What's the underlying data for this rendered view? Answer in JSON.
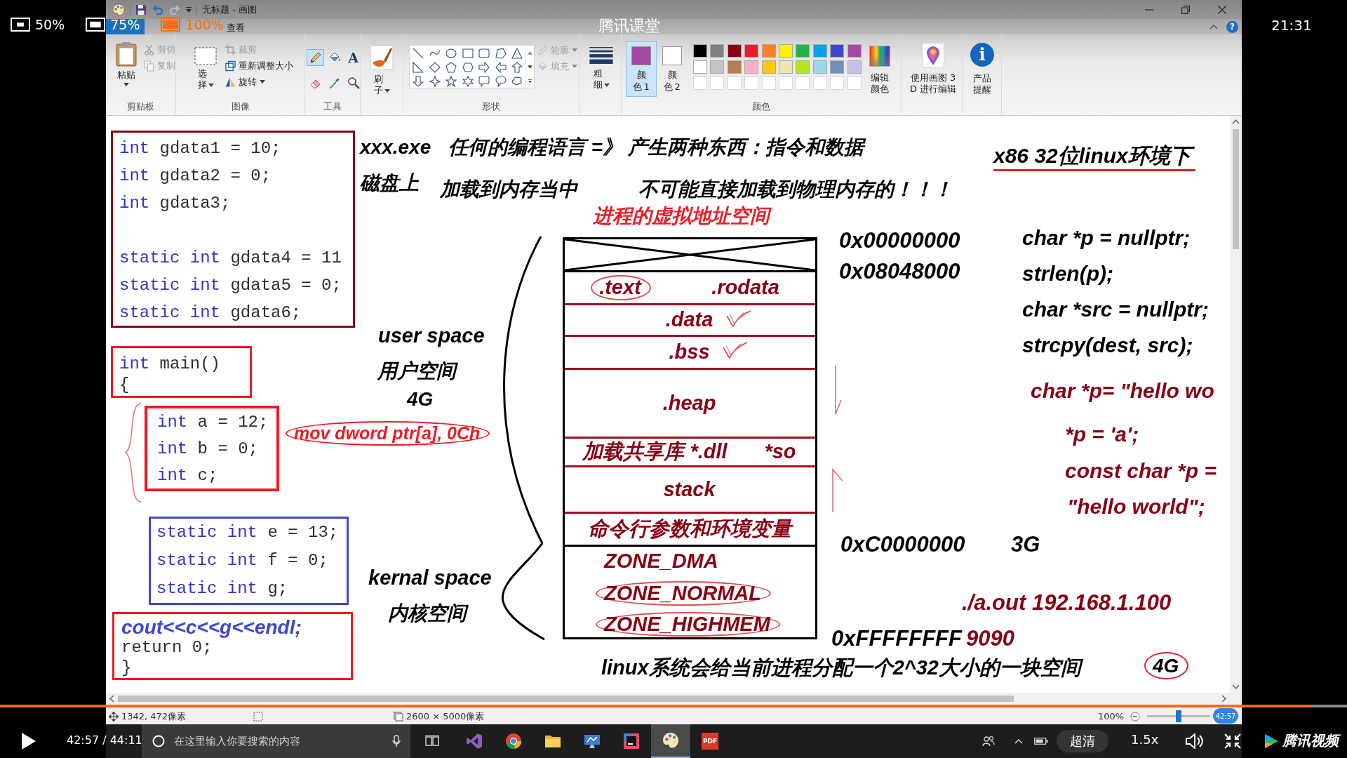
{
  "player": {
    "screen_options": [
      {
        "label": "50%",
        "selected": false
      },
      {
        "label": "75%",
        "selected": false
      },
      {
        "label": "100%",
        "selected": true
      }
    ],
    "title": "腾讯课堂",
    "clock": "21:31",
    "progress": {
      "level": 0.973
    },
    "hover_time": "42:57",
    "time": "42:57 / 44:11",
    "definition": "超清",
    "speed": "1.5x",
    "brand": "腾讯视频"
  },
  "window": {
    "title": "无标题 - 画图",
    "help": "?",
    "quick_access": [
      {
        "disabled": false
      },
      {
        "disabled": false
      },
      {
        "disabled": true
      }
    ]
  },
  "tabs": [
    {
      "label": "查看",
      "selected": false
    }
  ],
  "ribbon": {
    "clipboard": {
      "label": "剪贴板",
      "paste": "粘贴",
      "actions": [
        {
          "label": "剪切",
          "disabled": true
        },
        {
          "label": "复制",
          "disabled": true
        }
      ]
    },
    "image": {
      "label": "图像",
      "select": "选择",
      "actions": [
        {
          "label": "裁剪",
          "disabled": true
        },
        {
          "label": "重新调整大小",
          "disabled": false
        },
        {
          "label": "旋转",
          "disabled": false
        }
      ]
    },
    "tools": {
      "label": "工具",
      "items": [
        {
          "selected": true
        },
        {
          "selected": false
        },
        {
          "selected": false,
          "glyph": "A"
        },
        {
          "selected": false
        },
        {
          "selected": false
        },
        {
          "selected": false
        }
      ]
    },
    "brushes": {
      "label": "刷子"
    },
    "shapes": {
      "label": "形状",
      "actions": [
        {
          "label": "轮廓",
          "disabled": true
        },
        {
          "label": "填充",
          "disabled": true
        }
      ]
    },
    "size": {
      "label": "粗细"
    },
    "colors": {
      "label": "颜色",
      "active": [
        {
          "label": "颜色 1",
          "color": "#a349a4",
          "selected": true
        },
        {
          "label": "颜色 2",
          "color": "#ffffff",
          "selected": false
        }
      ],
      "palette": [
        {
          "color": "#000000"
        },
        {
          "color": "#7f7f7f"
        },
        {
          "color": "#880015"
        },
        {
          "color": "#ed1c24"
        },
        {
          "color": "#ff7f27"
        },
        {
          "color": "#fff200"
        },
        {
          "color": "#22b14c"
        },
        {
          "color": "#00a2e8"
        },
        {
          "color": "#3f48cc"
        },
        {
          "color": "#a349a4"
        },
        {
          "color": "#ffffff"
        },
        {
          "color": "#c3c3c3"
        },
        {
          "color": "#b97a57"
        },
        {
          "color": "#ffaec9"
        },
        {
          "color": "#ffc90e"
        },
        {
          "color": "#efe4b0"
        },
        {
          "color": "#b5e61d"
        },
        {
          "color": "#99d9ea"
        },
        {
          "color": "#7092be"
        },
        {
          "color": "#c8bfe7"
        }
      ],
      "edit": "编辑颜色"
    },
    "paint3d": "使用画图 3\nD 进行编辑",
    "notice": {
      "label": "产品提醒",
      "glyph": "i"
    }
  },
  "canvas": {
    "code_boxes": [
      {
        "color": "#880015",
        "blocks": [
          [
            {
              "keyword": "int",
              "code": "gdata1 = 10;"
            },
            {
              "keyword": "int",
              "code": "gdata2 = 0;"
            },
            {
              "keyword": "int",
              "code": "gdata3;"
            }
          ],
          [
            {
              "keyword": "static int",
              "code": "gdata4 = 11"
            },
            {
              "keyword": "static int",
              "code": "gdata5 = 0;"
            },
            {
              "keyword": "static int",
              "code": "gdata6;"
            }
          ]
        ]
      },
      {
        "color": "#ed1c24",
        "blocks": [
          [
            {
              "keyword": "int",
              "code": "main()"
            },
            {
              "code": "{"
            }
          ]
        ]
      },
      {
        "color": "#ed1c24",
        "blocks": [
          [
            {
              "keyword": "int",
              "code": "a = 12;"
            },
            {
              "keyword": "int",
              "code": "b = 0;"
            },
            {
              "keyword": "int",
              "code": "c;"
            }
          ]
        ]
      },
      {
        "color": "#3f48cc",
        "blocks": [
          [
            {
              "keyword": "static int",
              "code": "e = 13;"
            },
            {
              "keyword": "static int",
              "code": "f = 0;"
            },
            {
              "keyword": "static int",
              "code": "g;"
            }
          ]
        ]
      },
      {
        "color": "#ed1c24",
        "blocks": [
          [
            {
              "kind": "note",
              "code": "cout<<c<<g<<endl;"
            },
            {
              "kind": "code",
              "code": "return 0;"
            },
            {
              "kind": "code",
              "code": "}"
            }
          ]
        ]
      }
    ],
    "annotations": [
      {
        "text": "xxx.exe",
        "color": "#000000",
        "underlined": false,
        "circled": false
      },
      {
        "text": "任何的编程语言 =》 产生两种东西：指令和数据",
        "color": "#000000",
        "underlined": false,
        "circled": false
      },
      {
        "text": "x86 32位linux环境下",
        "color": "#000000",
        "underlined": true,
        "circled": false
      },
      {
        "text": "磁盘上",
        "color": "#000000",
        "underlined": false,
        "circled": false
      },
      {
        "text": "加载到内存当中",
        "color": "#000000",
        "underlined": false,
        "circled": false
      },
      {
        "text": "不可能直接加载到物理内存的！！！",
        "color": "#000000",
        "underlined": false,
        "circled": false
      },
      {
        "text": "0x00000000",
        "color": "#000000",
        "underlined": false,
        "circled": false
      },
      {
        "text": "char *p = nullptr;",
        "color": "#000000",
        "underlined": false,
        "circled": false
      },
      {
        "text": "0x08048000",
        "color": "#000000",
        "underlined": false,
        "circled": false
      },
      {
        "text": "strlen(p);",
        "color": "#000000",
        "underlined": false,
        "circled": false
      },
      {
        "text": "char *src = nullptr;",
        "color": "#000000",
        "underlined": false,
        "circled": false
      },
      {
        "text": "user space",
        "color": "#000000",
        "underlined": false,
        "circled": false
      },
      {
        "text": "strcpy(dest, src);",
        "color": "#000000",
        "underlined": false,
        "circled": false
      },
      {
        "text": "用户空间",
        "color": "#000000",
        "underlined": false,
        "circled": false
      },
      {
        "text": "4G",
        "color": "#000000",
        "underlined": false,
        "circled": false
      },
      {
        "text": "char *p= \"hello wo",
        "color": "#880015",
        "underlined": false,
        "circled": false
      },
      {
        "text": "mov dword ptr[a], 0Ch",
        "color": "#ed1c24",
        "underlined": false,
        "circled": true
      },
      {
        "text": "*p = 'a';",
        "color": "#880015",
        "underlined": false,
        "circled": false
      },
      {
        "text": "const char *p =",
        "color": "#880015",
        "underlined": false,
        "circled": false
      },
      {
        "text": "\"hello world\";",
        "color": "#880015",
        "underlined": false,
        "circled": false
      },
      {
        "text": "0xC0000000",
        "color": "#000000",
        "underlined": false,
        "circled": false
      },
      {
        "text": "3G",
        "color": "#000000",
        "underlined": false,
        "circled": false
      },
      {
        "text": "kernal space",
        "color": "#000000",
        "underlined": false,
        "circled": false
      },
      {
        "text": "内核空间",
        "color": "#000000",
        "underlined": false,
        "circled": false
      },
      {
        "text": "./a.out 192.168.1.100",
        "color": "#880015",
        "underlined": false,
        "circled": false
      },
      {
        "text": "0xFFFFFFFF",
        "color": "#000000",
        "underlined": false,
        "circled": false
      },
      {
        "text": "9090",
        "color": "#880015",
        "underlined": false,
        "circled": false
      },
      {
        "text": "linux系统会给当前进程分配一个2^32大小的一块空间",
        "color": "#000000",
        "underlined": false,
        "circled": false
      },
      {
        "text": "4G",
        "color": "#000000",
        "underlined": false,
        "circled": true
      }
    ],
    "memory": {
      "title": "进程的虚拟地址空间",
      "sections": [
        {
          "kind": "reserved"
        },
        {
          "kind": "user",
          "labels": [
            {
              "text": ".text",
              "circled": true
            },
            {
              "text": ".rodata",
              "circled": false
            }
          ]
        },
        {
          "kind": "user",
          "labels": [
            {
              "text": ".data",
              "circled": false
            }
          ]
        },
        {
          "kind": "user",
          "labels": [
            {
              "text": ".bss",
              "circled": false
            }
          ]
        },
        {
          "kind": "user",
          "labels": [
            {
              "text": ".heap",
              "circled": false
            }
          ]
        },
        {
          "kind": "user",
          "labels": [
            {
              "text": "加载共享库 *.dll",
              "circled": false
            },
            {
              "text": "*so",
              "circled": false
            }
          ]
        },
        {
          "kind": "user",
          "labels": [
            {
              "text": "stack",
              "circled": false
            }
          ]
        },
        {
          "kind": "user",
          "labels": [
            {
              "text": "命令行参数和环境变量",
              "circled": false
            }
          ]
        },
        {
          "kind": "kernel",
          "labels": [
            {
              "text": "ZONE_DMA",
              "circled": false
            }
          ]
        },
        {
          "kind": "kernel",
          "labels": [
            {
              "text": "ZONE_NORMAL",
              "circled": true
            }
          ]
        },
        {
          "kind": "kernel",
          "labels": [
            {
              "text": "ZONE_HIGHMEM",
              "circled": true
            }
          ]
        }
      ]
    }
  },
  "status_bar": {
    "cursor": "1342, 472像素",
    "canvas_size": "2600 × 5000像素",
    "zoom": {
      "label": "100%",
      "level": 0.5
    }
  },
  "taskbar": {
    "search_placeholder": "在这里输入你要搜索的内容",
    "apps": [
      {
        "active": false
      },
      {
        "active": false
      },
      {
        "active": false
      },
      {
        "active": false
      },
      {
        "active": false
      },
      {
        "active": true
      },
      {
        "active": false,
        "label": "PDF"
      }
    ]
  }
}
